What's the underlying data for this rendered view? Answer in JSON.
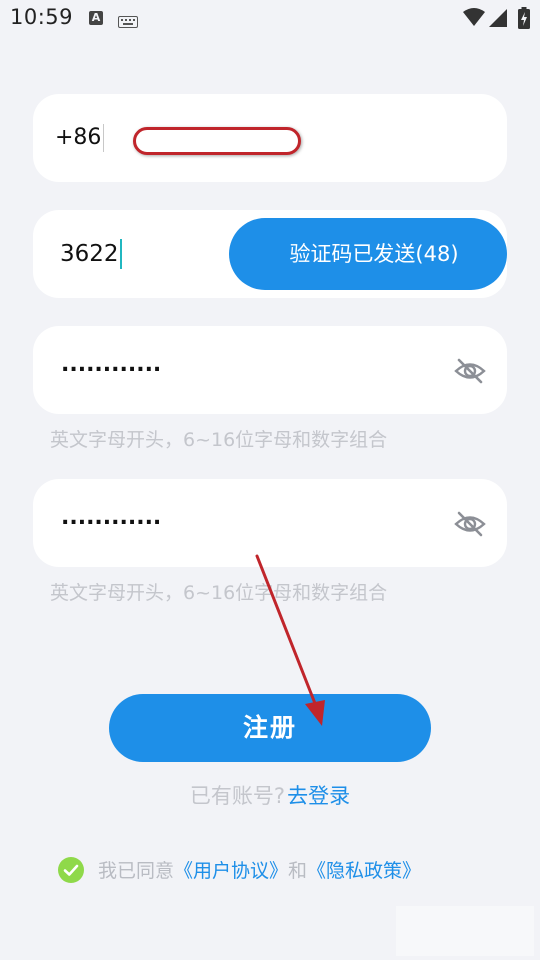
{
  "status_bar": {
    "time": "10:59",
    "a_badge": "A"
  },
  "form": {
    "phone": {
      "country_code": "+86"
    },
    "code": {
      "value": "3622",
      "send_button_label": "验证码已发送(48)"
    },
    "password": {
      "masked_value": "............",
      "hint": "英文字母开头，6~16位字母和数字组合"
    },
    "confirm_password": {
      "masked_value": "............",
      "hint": "英文字母开头，6~16位字母和数字组合"
    }
  },
  "actions": {
    "register_label": "注册",
    "login_prompt": "已有账号?",
    "login_link": "去登录"
  },
  "agreement": {
    "prefix": "我已同意",
    "user_agreement": "《用户协议》",
    "conjunction": "和",
    "privacy_policy": "《隐私政策》",
    "checked": true
  },
  "colors": {
    "accent": "#1e8fe8",
    "background": "#f2f3f7",
    "check": "#8fd94a",
    "annotation": "#c0252b"
  },
  "icons": {
    "eye": "eye-off-icon",
    "check": "check-circle-icon",
    "wifi": "wifi-icon",
    "signal": "signal-icon",
    "battery": "battery-charging-icon"
  }
}
